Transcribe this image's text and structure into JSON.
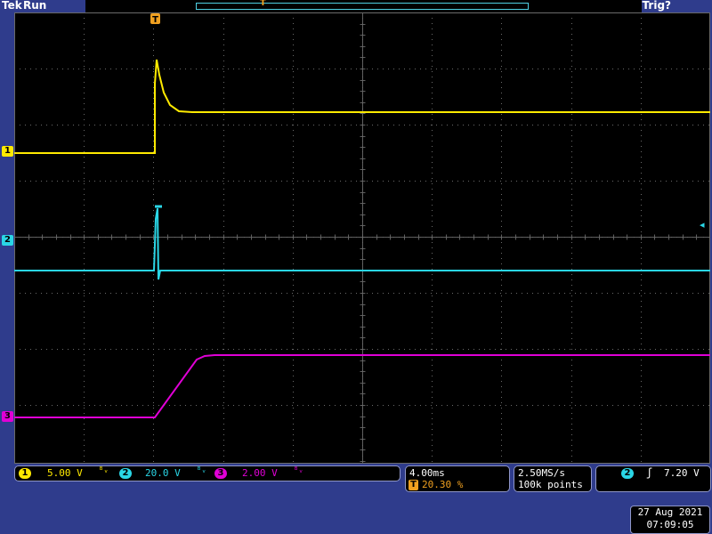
{
  "header": {
    "brand": "Tek",
    "state": "Run",
    "trigger_status": "Trig?",
    "trigger_marker": "T"
  },
  "channels": [
    {
      "id": "1",
      "label": "1",
      "scale": "5.00 V",
      "color": "#ffea00"
    },
    {
      "id": "2",
      "label": "2",
      "scale": "20.0 V",
      "color": "#2ad6e6"
    },
    {
      "id": "3",
      "label": "3",
      "scale": "2.00 V",
      "color": "#e000d6"
    }
  ],
  "coupling_symbol": "ᴮᵥ",
  "timebase": {
    "scale": "4.00ms",
    "trigger_marker": "T",
    "position": "20.30 %"
  },
  "acquisition": {
    "sample_rate": "2.50MS/s",
    "record_length": "100k points"
  },
  "trigger": {
    "source": "2",
    "slope_symbol": "ʃ",
    "level": "7.20 V"
  },
  "datetime": {
    "date": "27 Aug 2021",
    "time": "07:09:05"
  },
  "colors": {
    "background": "#2f3c8c",
    "screen": "#000000",
    "trigger_orange": "#f0a020",
    "grid": "#6a6a6a"
  }
}
